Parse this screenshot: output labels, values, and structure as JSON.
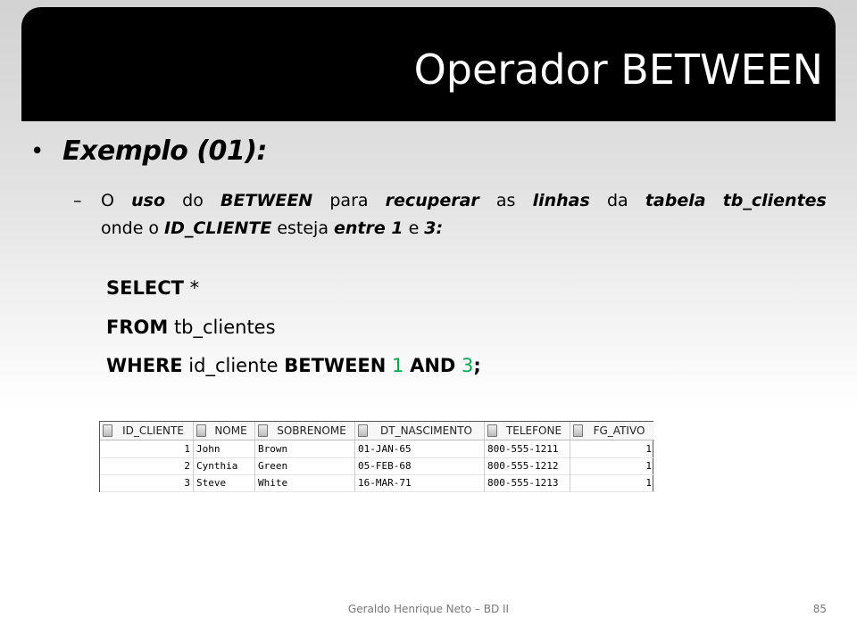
{
  "slide": {
    "title": "Operador BETWEEN",
    "bullet": "Exemplo (01):",
    "sub_line1": [
      {
        "text": "O",
        "style": "normal"
      },
      {
        "text": "uso",
        "style": "bi"
      },
      {
        "text": "do",
        "style": "normal"
      },
      {
        "text": "BETWEEN",
        "style": "bi"
      },
      {
        "text": "para",
        "style": "normal"
      },
      {
        "text": "recuperar",
        "style": "bi"
      },
      {
        "text": "as",
        "style": "normal"
      },
      {
        "text": "linhas",
        "style": "bi"
      },
      {
        "text": "da",
        "style": "normal"
      },
      {
        "text": "tabela",
        "style": "bi"
      },
      {
        "text": "tb_clientes",
        "style": "bi"
      }
    ],
    "sub_line2": [
      {
        "text": "onde",
        "style": "normal"
      },
      {
        "text": "o",
        "style": "normal"
      },
      {
        "text": "ID_CLIENTE",
        "style": "bi"
      },
      {
        "text": "esteja",
        "style": "normal"
      },
      {
        "text": "entre 1",
        "style": "bi"
      },
      {
        "text": "e",
        "style": "normal"
      },
      {
        "text": "3:",
        "style": "bi"
      }
    ],
    "sql": {
      "line1_kw": "SELECT",
      "line1_rest": " *",
      "line2_kw": "FROM",
      "line2_rest": " tb_clientes",
      "line3_kw1": "WHERE",
      "line3_mid": " id_cliente ",
      "line3_kw2": "BETWEEN",
      "line3_n1": "1",
      "line3_kw3": "AND",
      "line3_n2": "3",
      "line3_end": ";"
    }
  },
  "result_grid": {
    "columns": [
      "ID_CLIENTE",
      "NOME",
      "SOBRENOME",
      "DT_NASCIMENTO",
      "TELEFONE",
      "FG_ATIVO"
    ],
    "rows": [
      [
        "1",
        "John",
        "Brown",
        "01-JAN-65",
        "800-555-1211",
        "1"
      ],
      [
        "2",
        "Cynthia",
        "Green",
        "05-FEB-68",
        "800-555-1212",
        "1"
      ],
      [
        "3",
        "Steve",
        "White",
        "16-MAR-71",
        "800-555-1213",
        "1"
      ]
    ]
  },
  "footer": {
    "author": "Geraldo Henrique Neto – BD II",
    "page_number": "85"
  }
}
